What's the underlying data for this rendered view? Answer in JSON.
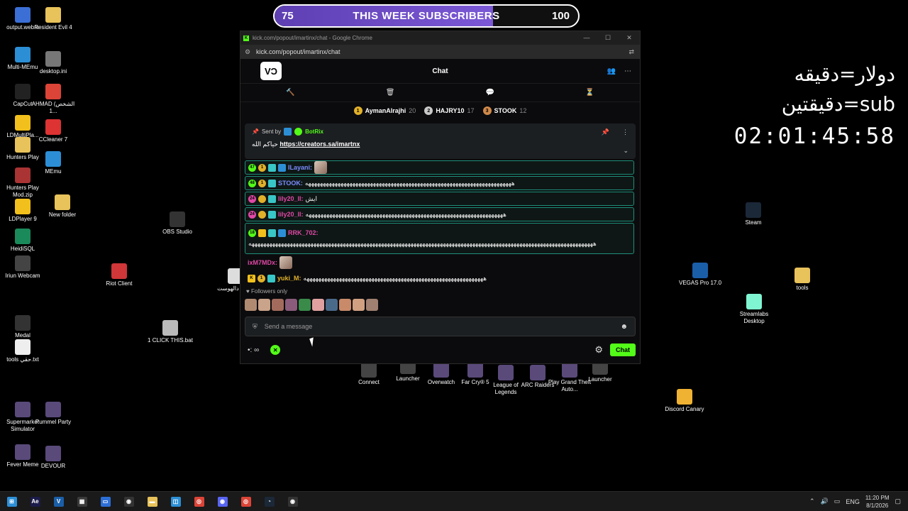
{
  "goal": {
    "start": "75",
    "title": "THIS WEEK SUBSCRIBERS",
    "end": "100",
    "progress_fraction": 0.72
  },
  "overlay": {
    "line1": "دولار=دقيقه",
    "line2": "sub=دقيقتين",
    "timer": "02:01:45:58"
  },
  "desktop_icons": [
    {
      "label": "output.webm",
      "icon": "video-file-icon"
    },
    {
      "label": "Resident Evil 4",
      "icon": "folder-icon"
    },
    {
      "label": "Multi-MEmu",
      "icon": "memu-icon"
    },
    {
      "label": "desktop.ini",
      "icon": "ini-file-icon"
    },
    {
      "label": "CapCut",
      "icon": "capcut-icon"
    },
    {
      "label": "AHMAD (الشخص 1...",
      "icon": "chrome-icon"
    },
    {
      "label": "LDMultiPla...",
      "icon": "ldplayer-icon"
    },
    {
      "label": "CCleaner 7",
      "icon": "ccleaner-icon"
    },
    {
      "label": "Hunters Play",
      "icon": "folder-icon"
    },
    {
      "label": "MEmu",
      "icon": "memu-icon"
    },
    {
      "label": "Hunters Play Mod.zip",
      "icon": "zip-icon"
    },
    {
      "label": "LDPlayer 9",
      "icon": "ldplayer-icon"
    },
    {
      "label": "New folder",
      "icon": "folder-icon"
    },
    {
      "label": "HeidiSQL",
      "icon": "heidisql-icon"
    },
    {
      "label": "OBS Studio",
      "icon": "obs-icon"
    },
    {
      "label": "Iriun Webcam",
      "icon": "webcam-icon"
    },
    {
      "label": "Riot Client",
      "icon": "riot-icon"
    },
    {
      "label": "البرت دالهوست",
      "icon": "file-icon"
    },
    {
      "label": "Medal",
      "icon": "medal-icon"
    },
    {
      "label": "1 CLICK THIS.bat",
      "icon": "bat-file-icon"
    },
    {
      "label": "tools حقي.txt",
      "icon": "txt-file-icon"
    },
    {
      "label": "Supermarket Simulator",
      "icon": "game-icon"
    },
    {
      "label": "Pummel Party",
      "icon": "game-icon"
    },
    {
      "label": "Fever Meme",
      "icon": "game-icon"
    },
    {
      "label": "DEVOUR",
      "icon": "game-icon"
    },
    {
      "label": "Steam",
      "icon": "steam-icon"
    },
    {
      "label": "VEGAS Pro 17.0",
      "icon": "vegas-icon"
    },
    {
      "label": "tools",
      "icon": "folder-icon"
    },
    {
      "label": "Streamlabs Desktop",
      "icon": "streamlabs-icon"
    },
    {
      "label": "Discord Canary",
      "icon": "discord-icon"
    },
    {
      "label": "Connect",
      "icon": "app-icon"
    },
    {
      "label": "Launcher",
      "icon": "app-icon"
    },
    {
      "label": "Overwatch",
      "icon": "game-icon"
    },
    {
      "label": "Far Cry® 5",
      "icon": "game-icon"
    },
    {
      "label": "League of Legends",
      "icon": "game-icon"
    },
    {
      "label": "ARC Raiders",
      "icon": "game-icon"
    },
    {
      "label": "Play Grand Theft Auto...",
      "icon": "game-icon"
    },
    {
      "label": "Launcher",
      "icon": "app-icon"
    }
  ],
  "window": {
    "title": "kick.com/popout/imartinx/chat - Google Chrome",
    "url": "kick.com/popout/imartinx/chat",
    "controls": [
      "—",
      "☐",
      "✕"
    ]
  },
  "chat": {
    "logo": "VƆ",
    "title": "Chat",
    "toolbar": [
      "hammer-icon",
      "trash-icon",
      "chat-bubble-icon",
      "hourglass-icon"
    ],
    "leaderboard": [
      {
        "rank": "1",
        "name": "AymanAlrajhi",
        "count": "20",
        "color": "#e2b12a"
      },
      {
        "rank": "2",
        "name": "HAJRY10",
        "count": "17",
        "color": "#c9c9c9"
      },
      {
        "rank": "3",
        "name": "STOOK",
        "count": "12",
        "color": "#d08a4a"
      }
    ],
    "pinned": {
      "sent_by": "Sent by",
      "bot": "BotRix",
      "prefix": "حياكم الله",
      "link": "https://creators.sa/imartnx"
    },
    "messages": [
      {
        "badges": [
          "47",
          "1",
          "",
          ""
        ],
        "user": "ILayani",
        "user_color": "#7b8cff",
        "text": "",
        "emote": true,
        "highlight": true
      },
      {
        "badges": [
          "48",
          "1",
          ""
        ],
        "user": "STOOK",
        "user_color": "#7b8cff",
        "text": "ههههههههههههههههههههههههههههههههههههههههههههههههههههههههههههههههههههههه",
        "highlight": true
      },
      {
        "badges": [
          "24",
          "",
          ""
        ],
        "user": "lily20_ll",
        "user_color": "#e048a6",
        "text": "ايش",
        "highlight": true
      },
      {
        "badges": [
          "24",
          "",
          ""
        ],
        "user": "lily20_ll",
        "user_color": "#e048a6",
        "text": "هههههههههههههههههههههههههههههههههههههههههههههههههههههههههههههههههههه",
        "highlight": true
      },
      {
        "badges": [
          "18",
          "",
          "",
          ""
        ],
        "user": "RRK_702",
        "user_color": "#e048a6",
        "text": "هههههههههههههههههههههههههههههههههههههههههههههههههههههههههههههههههههههههههههههههههههههههههههههههههههههههههههههههههههههه",
        "highlight": true,
        "multi": true
      },
      {
        "badges": [],
        "user": "ixM7MDx",
        "user_color": "#e048a6",
        "text": "",
        "emote": true,
        "highlight": false
      },
      {
        "badges": [
          "K",
          "1",
          ""
        ],
        "user": "yuki_M",
        "user_color": "#e2b12a",
        "text": "هههههههههههههههههههههههههههههههههههههههههههههههههههههههههههههه",
        "highlight": false
      }
    ],
    "followers_only": "Followers only",
    "emote_colors": [
      "#b08a70",
      "#c9a38a",
      "#a36b5c",
      "#8a5b7b",
      "#3a8a4a",
      "#e0a0a0",
      "#4a6a8a",
      "#c98a6a",
      "#d0a080",
      "#a08070"
    ],
    "composer_placeholder": "Send a message",
    "send_label": "Chat",
    "points": "∞"
  },
  "taskbar": {
    "apps": [
      "windows-icon",
      "after-effects-icon",
      "vegas-icon",
      "calculator-icon",
      "window-icon",
      "obs-icon",
      "file-explorer-icon",
      "store-icon",
      "chrome-icon",
      "discord-icon",
      "chrome-icon",
      "steam-icon",
      "obs-icon"
    ],
    "lang": "ENG",
    "time": "11:20 PM",
    "date": "8/1/2026"
  }
}
